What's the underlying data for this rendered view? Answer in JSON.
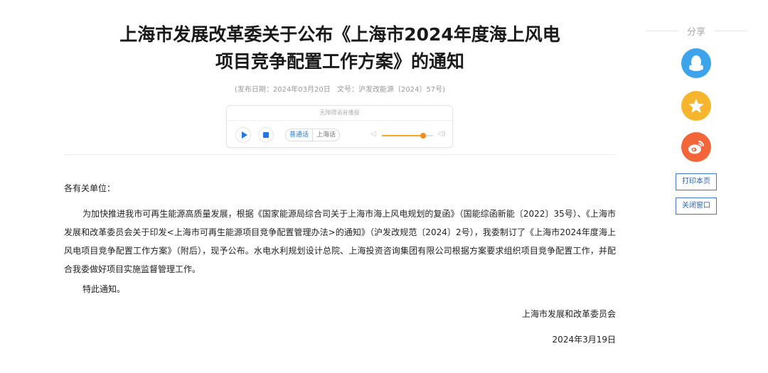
{
  "article": {
    "title_line1": "上海市发展改革委关于公布《上海市2024年度海上风电",
    "title_line2": "项目竞争配置工作方案》的通知",
    "publish_date": "(发布日期：2024年03月20日",
    "doc_number": "文号：沪发改能源〔2024〕57号)",
    "salutation": "各有关单位：",
    "body": "为加快推进我市可再生能源高质量发展，根据《国家能源局综合司关于上海市海上风电规划的复函》（国能综函新能〔2022〕35号）、《上海市发展和改革委员会关于印发<上海市可再生能源项目竞争配置管理办法>的通知》（沪发改规范〔2024〕2号），我委制订了《上海市2024年度海上风电项目竞争配置工作方案》（附后），现予公布。水电水利规划设计总院、上海投资咨询集团有限公司根据方案要求组织项目竞争配置工作，并配合我委做好项目实施监督管理工作。",
    "closing": "特此通知。",
    "signer": "上海市发展和改革委员会",
    "date": "2024年3月19日"
  },
  "player": {
    "title": "无障碍语音播报",
    "lang_mandarin": "普通话",
    "lang_shanghainese": "上海话",
    "volume": 0.8,
    "accent_color": "#1e78e6",
    "volume_color": "#f08a24"
  },
  "sidebar": {
    "share_label": "分享",
    "share_buttons": [
      {
        "icon": "qq-icon",
        "color": "#3da3ea"
      },
      {
        "icon": "qzone-star-icon",
        "color": "#f5b52d"
      },
      {
        "icon": "weibo-icon",
        "color": "#f2663a"
      }
    ],
    "print_label": "打印本页",
    "close_label": "关闭窗口"
  }
}
